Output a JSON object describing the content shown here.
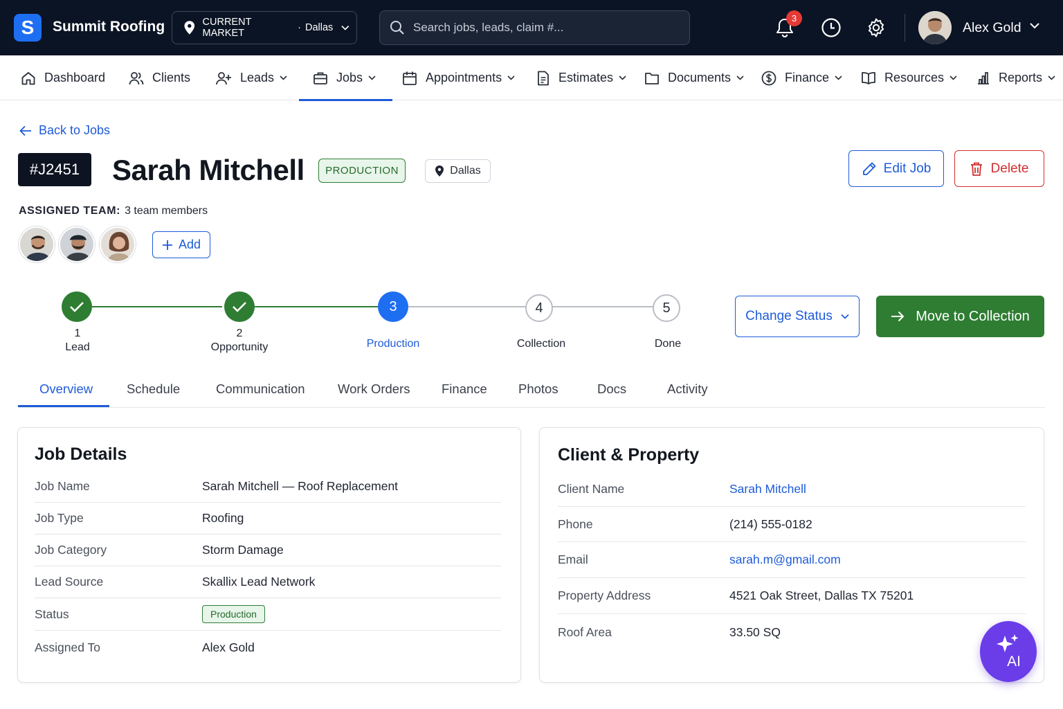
{
  "app": {
    "logo_letter": "S",
    "brand_name": "Summit Roofing",
    "market_label": "CURRENT MARKET",
    "market_separator": "·",
    "market_value": "Dallas",
    "search_placeholder": "Search jobs, leads, claim #...",
    "notification_count": "3",
    "user_name": "Alex Gold"
  },
  "nav": {
    "items": [
      {
        "label": "Dashboard",
        "icon": "home-icon"
      },
      {
        "label": "Clients",
        "icon": "users-icon"
      },
      {
        "label": "Leads",
        "icon": "user-plus-icon"
      },
      {
        "label": "Jobs",
        "icon": "briefcase-icon",
        "active": true
      },
      {
        "label": "Appointments",
        "icon": "calendar-icon"
      },
      {
        "label": "Estimates",
        "icon": "document-icon"
      },
      {
        "label": "Documents",
        "icon": "folder-icon"
      },
      {
        "label": "Finance",
        "icon": "dollar-icon"
      },
      {
        "label": "Resources",
        "icon": "book-icon"
      },
      {
        "label": "Reports",
        "icon": "bar-chart-icon"
      }
    ]
  },
  "header": {
    "back_label": "Back to Jobs",
    "job_id": "#J2451",
    "client_name": "Sarah Mitchell",
    "stage_badge": "PRODUCTION",
    "location": "Dallas",
    "edit_label": "Edit Job",
    "delete_label": "Delete"
  },
  "team": {
    "label": "ASSIGNED TEAM:",
    "count_text": "3 team members",
    "add_label": "Add"
  },
  "stepper": {
    "steps": [
      {
        "number": "1",
        "label": "Lead",
        "state": "done"
      },
      {
        "number": "2",
        "label": "Opportunity",
        "state": "done"
      },
      {
        "number": "3",
        "label": "Production",
        "state": "current"
      },
      {
        "number": "4",
        "label": "Collection",
        "state": "todo"
      },
      {
        "number": "5",
        "label": "Done",
        "state": "todo"
      }
    ],
    "change_status_label": "Change Status",
    "move_label": "Move to Collection"
  },
  "tabs": [
    "Overview",
    "Schedule",
    "Communication",
    "Work Orders",
    "Finance",
    "Photos",
    "Docs",
    "Activity"
  ],
  "job_details": {
    "title": "Job Details",
    "rows": [
      {
        "label": "Job Name",
        "value": "Sarah Mitchell — Roof Replacement"
      },
      {
        "label": "Job Type",
        "value": "Roofing"
      },
      {
        "label": "Job Category",
        "value": "Storm Damage"
      },
      {
        "label": "Lead Source",
        "value": "Skallix Lead Network"
      },
      {
        "label": "Status",
        "value": "Production"
      },
      {
        "label": "Assigned To",
        "value": "Alex Gold"
      }
    ]
  },
  "client_property": {
    "title": "Client & Property",
    "rows": [
      {
        "label": "Client Name",
        "value": "Sarah Mitchell"
      },
      {
        "label": "Phone",
        "value": "(214) 555-0182"
      },
      {
        "label": "Email",
        "value": "sarah.m@gmail.com"
      },
      {
        "label": "Property Address",
        "value": "4521 Oak Street, Dallas TX 75201"
      },
      {
        "label": "Roof Area",
        "value": "33.50 SQ"
      }
    ]
  },
  "ai": {
    "label": "AI"
  },
  "colors": {
    "topbar": "#0b1424",
    "primary": "#1e5bd8",
    "success": "#2e7d32",
    "danger": "#d32f2f",
    "ai": "#6a3de8"
  }
}
